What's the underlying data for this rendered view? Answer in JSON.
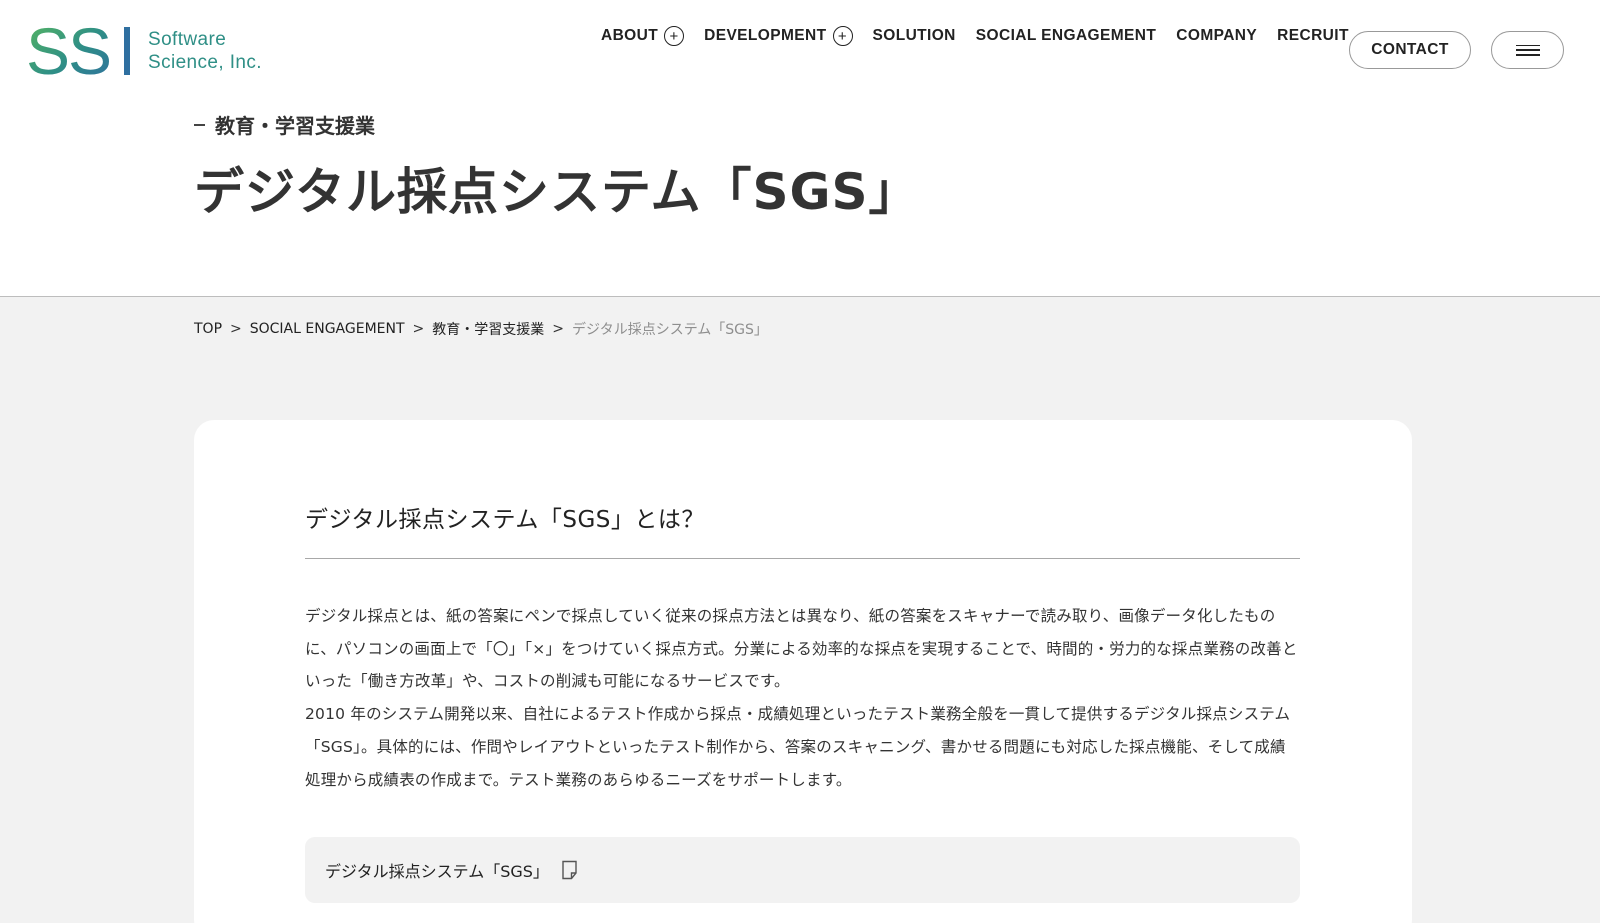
{
  "brand": {
    "logo_mark": "SSI",
    "name_line1": "Software",
    "name_line2": "Science, Inc.",
    "colors": {
      "green": "#4caf6b",
      "teal": "#2f8f86",
      "blue": "#2f6fa0"
    }
  },
  "nav": {
    "items": [
      {
        "label": "ABOUT",
        "expandable": true
      },
      {
        "label": "DEVELOPMENT",
        "expandable": true
      },
      {
        "label": "SOLUTION",
        "expandable": false
      },
      {
        "label": "SOCIAL ENGAGEMENT",
        "expandable": false
      },
      {
        "label": "COMPANY",
        "expandable": false
      },
      {
        "label": "RECRUIT",
        "expandable": false
      }
    ],
    "contact_label": "CONTACT",
    "menu_icon": "hamburger-icon"
  },
  "hero": {
    "category": "教育・学習支援業",
    "title": "デジタル採点システム「SGS」"
  },
  "breadcrumb": {
    "items": [
      "TOP",
      "SOCIAL ENGAGEMENT",
      "教育・学習支援業",
      "デジタル採点システム「SGS」"
    ]
  },
  "content": {
    "heading": "デジタル採点システム「SGS」とは？",
    "paragraph1": "デジタル採点とは、紙の答案にペンで採点していく従来の採点方法とは異なり、紙の答案をスキャナーで読み取り、画像データ化したものに、パソコンの画面上で「〇」「×」をつけていく採点方式。分業による効率的な採点を実現することで、時間的・労力的な採点業務の改善といった「働き方改革」や、コストの削減も可能になるサービスです。",
    "paragraph2": "2010 年のシステム開発以来、自社によるテスト作成から採点・成績処理といったテスト業務全般を一貫して提供するデジタル採点システム「SGS」。具体的には、作問やレイアウトといったテスト制作から、答案のスキャニング、書かせる問題にも対応した採点機能、そして成績処理から成績表の作成まで。テスト業務のあらゆるニーズをサポートします。",
    "link_label": "デジタル採点システム「SGS」",
    "link_icon": "document-icon"
  }
}
